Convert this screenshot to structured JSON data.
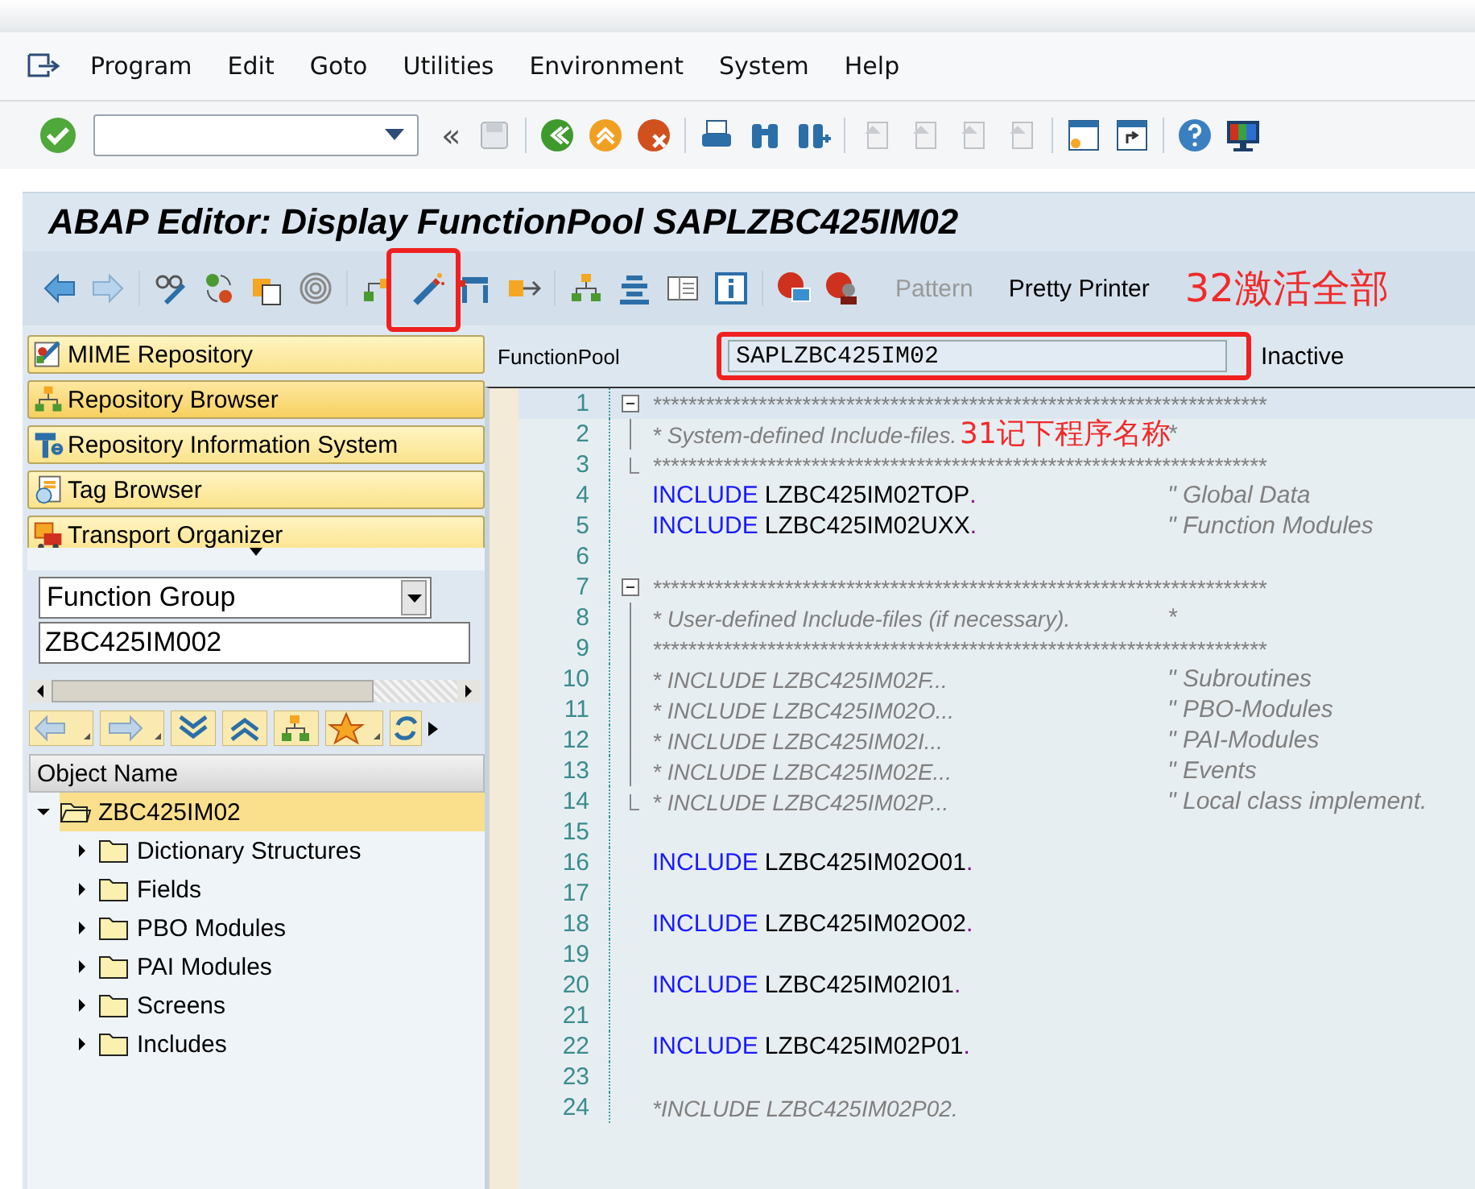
{
  "menu": [
    {
      "label": "Program"
    },
    {
      "label": "Edit"
    },
    {
      "label": "Goto"
    },
    {
      "label": "Utilities"
    },
    {
      "label": "Environment"
    },
    {
      "label": "System"
    },
    {
      "label": "Help"
    }
  ],
  "system_toolbar": {
    "collapse": "«"
  },
  "title": "ABAP Editor: Display FunctionPool SAPLZBC425IM02",
  "app_toolbar": {
    "buttons": [
      {
        "label": "Pattern",
        "disabled": true
      },
      {
        "label": "Pretty Printer",
        "disabled": false
      }
    ]
  },
  "navigation": {
    "buttons": [
      {
        "label": "MIME Repository",
        "selected": false
      },
      {
        "label": "Repository Browser",
        "selected": true
      },
      {
        "label": "Repository Information System",
        "selected": false
      },
      {
        "label": "Tag Browser",
        "selected": false
      },
      {
        "label": "Transport Organizer",
        "selected": false
      }
    ],
    "object_type": {
      "value": "Function Group"
    },
    "object_name": {
      "value": "ZBC425IM002"
    },
    "tree_header": "Object Name",
    "tree": [
      {
        "label": "ZBC425IM02",
        "expanded": true,
        "selected": true,
        "children": [
          {
            "label": "Dictionary Structures",
            "expanded": false,
            "selected": false
          },
          {
            "label": "Fields",
            "expanded": false,
            "selected": false
          },
          {
            "label": "PBO Modules",
            "expanded": false,
            "selected": false
          },
          {
            "label": "PAI Modules",
            "expanded": false,
            "selected": false
          },
          {
            "label": "Screens",
            "expanded": false,
            "selected": false
          },
          {
            "label": "Includes",
            "expanded": false,
            "selected": false
          }
        ]
      }
    ]
  },
  "program": {
    "label": "FunctionPool",
    "value": "SAPLZBC425IM02",
    "status": "Inactive"
  },
  "code": [
    {
      "n": "1",
      "kind": "comment",
      "expanded": true,
      "text": "**********************************************************************"
    },
    {
      "n": "2",
      "kind": "comment",
      "text": "*   System-defined Include-files.",
      "tail": "*"
    },
    {
      "n": "3",
      "kind": "comment",
      "text": "**********************************************************************"
    },
    {
      "n": "4",
      "kind": "include",
      "keyword": "INCLUDE",
      "name": "LZBC425IM02TOP",
      "dot": ".",
      "tail": "\" Global Data"
    },
    {
      "n": "5",
      "kind": "include",
      "keyword": "INCLUDE",
      "name": "LZBC425IM02UXX",
      "dot": ".",
      "tail": "\" Function Modules"
    },
    {
      "n": "6",
      "kind": "blank"
    },
    {
      "n": "7",
      "kind": "comment",
      "expanded": true,
      "text": "**********************************************************************"
    },
    {
      "n": "8",
      "kind": "comment",
      "text": "*   User-defined Include-files (if necessary).",
      "tail": "*"
    },
    {
      "n": "9",
      "kind": "comment",
      "text": "**********************************************************************"
    },
    {
      "n": "10",
      "kind": "comment",
      "text": "* INCLUDE LZBC425IM02F...",
      "tail": "\" Subroutines"
    },
    {
      "n": "11",
      "kind": "comment",
      "text": "* INCLUDE LZBC425IM02O...",
      "tail": "\" PBO-Modules"
    },
    {
      "n": "12",
      "kind": "comment",
      "text": "* INCLUDE LZBC425IM02I...",
      "tail": "\" PAI-Modules"
    },
    {
      "n": "13",
      "kind": "comment",
      "text": "* INCLUDE LZBC425IM02E...",
      "tail": "\" Events"
    },
    {
      "n": "14",
      "kind": "comment",
      "text": "* INCLUDE LZBC425IM02P...",
      "tail": "\" Local class implement."
    },
    {
      "n": "15",
      "kind": "blank"
    },
    {
      "n": "16",
      "kind": "include",
      "keyword": "INCLUDE",
      "name": "LZBC425IM02O01",
      "dot": "."
    },
    {
      "n": "17",
      "kind": "blank"
    },
    {
      "n": "18",
      "kind": "include",
      "keyword": "INCLUDE",
      "name": "LZBC425IM02O02",
      "dot": "."
    },
    {
      "n": "19",
      "kind": "blank"
    },
    {
      "n": "20",
      "kind": "include",
      "keyword": "INCLUDE",
      "name": "LZBC425IM02I01",
      "dot": "."
    },
    {
      "n": "21",
      "kind": "blank"
    },
    {
      "n": "22",
      "kind": "include",
      "keyword": "INCLUDE",
      "name": "LZBC425IM02P01",
      "dot": "."
    },
    {
      "n": "23",
      "kind": "blank"
    },
    {
      "n": "24",
      "kind": "comment",
      "text": "*INCLUDE LZBC425IM02P02."
    }
  ],
  "annotations": [
    {
      "text": "32激活全部"
    },
    {
      "text": "31记下程序名称"
    }
  ]
}
